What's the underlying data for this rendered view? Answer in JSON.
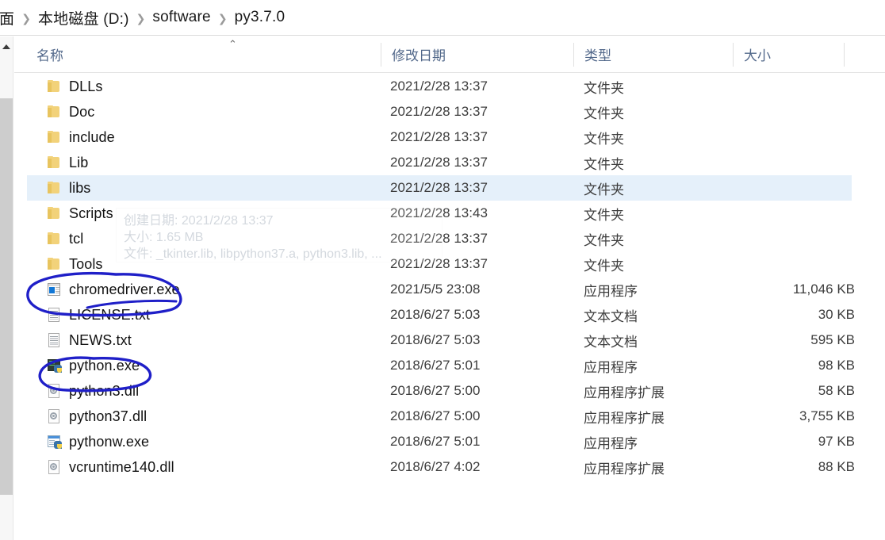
{
  "window": {
    "kind": "windows-file-explorer"
  },
  "breadcrumb": {
    "items": [
      {
        "label": "面",
        "clipped": true
      },
      {
        "label": "本地磁盘 (D:)",
        "clipped": false
      },
      {
        "label": "software",
        "clipped": false
      },
      {
        "label": "py3.7.0",
        "clipped": false
      }
    ],
    "separator": "❯"
  },
  "columns": {
    "name": "名称",
    "date": "修改日期",
    "type": "类型",
    "size": "大小",
    "sort_indicator": "⌃",
    "sorted_by": "名称"
  },
  "files": [
    {
      "name": "DLLs",
      "icon": "folder-icon",
      "date": "2021/2/28 13:37",
      "type": "文件夹",
      "size": "",
      "selected": false
    },
    {
      "name": "Doc",
      "icon": "folder-icon",
      "date": "2021/2/28 13:37",
      "type": "文件夹",
      "size": "",
      "selected": false
    },
    {
      "name": "include",
      "icon": "folder-icon",
      "date": "2021/2/28 13:37",
      "type": "文件夹",
      "size": "",
      "selected": false
    },
    {
      "name": "Lib",
      "icon": "folder-icon",
      "date": "2021/2/28 13:37",
      "type": "文件夹",
      "size": "",
      "selected": false
    },
    {
      "name": "libs",
      "icon": "folder-icon",
      "date": "2021/2/28 13:37",
      "type": "文件夹",
      "size": "",
      "selected": true
    },
    {
      "name": "Scripts",
      "icon": "folder-icon",
      "date": "2021/2/28 13:43",
      "type": "文件夹",
      "size": "",
      "selected": false
    },
    {
      "name": "tcl",
      "icon": "folder-icon",
      "date": "2021/2/28 13:37",
      "type": "文件夹",
      "size": "",
      "selected": false
    },
    {
      "name": "Tools",
      "icon": "folder-icon",
      "date": "2021/2/28 13:37",
      "type": "文件夹",
      "size": "",
      "selected": false
    },
    {
      "name": "chromedriver.exe",
      "icon": "application-icon",
      "date": "2021/5/5 23:08",
      "type": "应用程序",
      "size": "11,046 KB",
      "selected": false
    },
    {
      "name": "LICENSE.txt",
      "icon": "text-document-icon",
      "date": "2018/6/27 5:03",
      "type": "文本文档",
      "size": "30 KB",
      "selected": false
    },
    {
      "name": "NEWS.txt",
      "icon": "text-document-icon",
      "date": "2018/6/27 5:03",
      "type": "文本文档",
      "size": "595 KB",
      "selected": false
    },
    {
      "name": "python.exe",
      "icon": "python-console-icon",
      "date": "2018/6/27 5:01",
      "type": "应用程序",
      "size": "98 KB",
      "selected": false
    },
    {
      "name": "python3.dll",
      "icon": "dll-icon",
      "date": "2018/6/27 5:00",
      "type": "应用程序扩展",
      "size": "58 KB",
      "selected": false
    },
    {
      "name": "python37.dll",
      "icon": "dll-icon",
      "date": "2018/6/27 5:00",
      "type": "应用程序扩展",
      "size": "3,755 KB",
      "selected": false
    },
    {
      "name": "pythonw.exe",
      "icon": "python-window-icon",
      "date": "2018/6/27 5:01",
      "type": "应用程序",
      "size": "97 KB",
      "selected": false
    },
    {
      "name": "vcruntime140.dll",
      "icon": "dll-icon",
      "date": "2018/6/27 4:02",
      "type": "应用程序扩展",
      "size": "88 KB",
      "selected": false
    }
  ],
  "tooltip": {
    "visible": true,
    "for_item": "libs",
    "lines": [
      "创建日期: 2021/2/28 13:37",
      "大小: 1.65 MB",
      "文件: _tkinter.lib, libpython37.a, python3.lib, ..."
    ]
  },
  "annotations": {
    "color": "#1f1fc8",
    "shapes": [
      {
        "label": "circle-chromedriver-exe",
        "targets": "chromedriver.exe"
      },
      {
        "label": "circle-python-exe",
        "targets": "python.exe"
      }
    ]
  },
  "scrollbar": {
    "orientation": "vertical",
    "position": "left",
    "up_arrow": "▲"
  },
  "colors": {
    "selection": "#e5f0fa",
    "header_text": "#52688a",
    "folder": "#f2d27a",
    "annotation": "#1f1fc8"
  }
}
